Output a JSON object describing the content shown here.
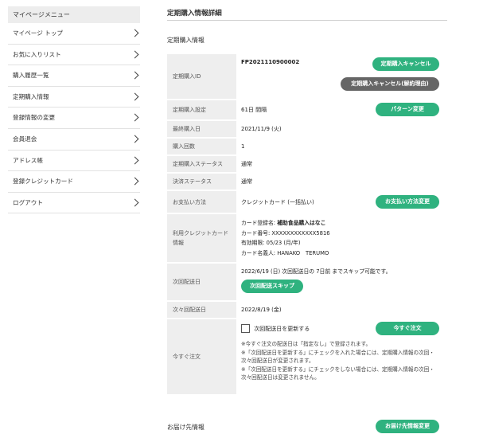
{
  "sidebar": {
    "heading": "マイページメニュー",
    "items": [
      {
        "label": "マイページ トップ"
      },
      {
        "label": "お気に入りリスト"
      },
      {
        "label": "購入履歴一覧"
      },
      {
        "label": "定期購入情報"
      },
      {
        "label": "登録情報の変更"
      },
      {
        "label": "会員退会"
      },
      {
        "label": "アドレス帳"
      },
      {
        "label": "登録クレジットカード"
      },
      {
        "label": "ログアウト"
      }
    ]
  },
  "main": {
    "page_title": "定期購入情報詳細",
    "section_title": "定期購入情報",
    "rows": {
      "id": {
        "label": "定期購入ID",
        "value": "FP2021110900002",
        "cancel_btn": "定期購入キャンセル",
        "cancel_reason_btn": "定期購入キャンセル(解約理由)"
      },
      "setting": {
        "label": "定期購入設定",
        "value": "61日 間隔",
        "pattern_btn": "パターン変更"
      },
      "last_purchase": {
        "label": "最終購入日",
        "value": "2021/11/9 (火)"
      },
      "count": {
        "label": "購入回数",
        "value": "1"
      },
      "status": {
        "label": "定期購入ステータス",
        "value": "通常"
      },
      "payment_status": {
        "label": "決済ステータス",
        "value": "通常"
      },
      "payment_method": {
        "label": "お支払い方法",
        "value": "クレジットカード (一括払い)",
        "change_btn": "お支払い方法変更"
      },
      "card": {
        "label_line1": "利用クレジットカード",
        "label_line2": "情報",
        "reg_prefix": "カード登録名: ",
        "reg_name": "補助食品購入はなこ",
        "number": "カード番号: XXXXXXXXXXXX5816",
        "expiry": "有効期限: 05/23 (月/年)",
        "holder": "カード名義人: HANAKO　TERUMO"
      },
      "next_delivery": {
        "label": "次回配送日",
        "date": "2022/6/19 (日)",
        "note": " 次回配送日の 7日前 までスキップ可能です。",
        "skip_btn": "次回配送スキップ"
      },
      "next_next": {
        "label": "次々回配送日",
        "value": "2022/8/19 (金)"
      },
      "order_now": {
        "label": "今すぐ注文",
        "checkbox_label": "次回配送日を更新する",
        "order_btn": "今すぐ注文",
        "note1": "※今すぐ注文の配送日は「指定なし」で登録されます。",
        "note2": "※「次回配送日を更新する」にチェックを入れた場合には、定期購入情報の次回・次々回配送日が変更されます。",
        "note3": "※「次回配送日を更新する」にチェックをしない場合には、定期購入情報の次回・次々回配送日は変更されません。"
      }
    },
    "delivery_section_title": "お届け先情報",
    "delivery_change_btn": "お届け先情報変更"
  },
  "colors": {
    "accent": "#2fb27f",
    "gray_button": "#666666",
    "label_bg": "#eeeeee"
  }
}
